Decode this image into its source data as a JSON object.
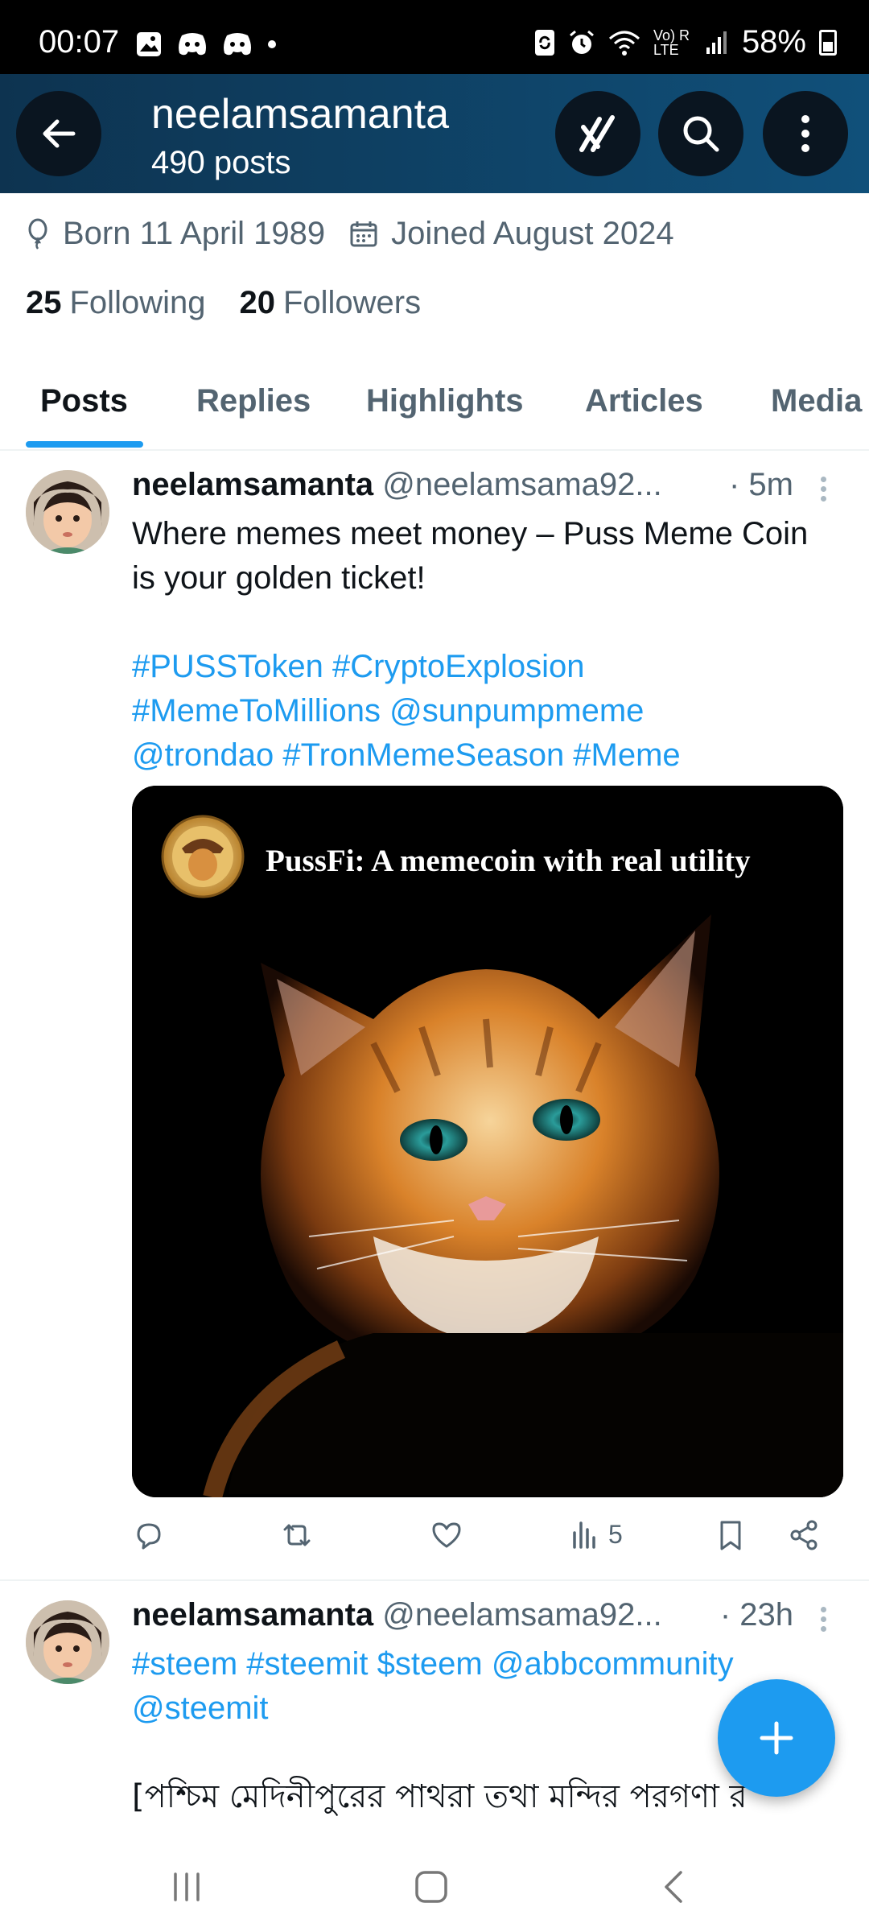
{
  "status_bar": {
    "time": "00:07",
    "battery": "58%",
    "network": "Vo) R LTE"
  },
  "header": {
    "name": "neelamsamanta",
    "posts_count": "490 posts"
  },
  "profile": {
    "born": "Born 11 April 1989",
    "joined": "Joined August 2024",
    "following_count": "25",
    "following_label": "Following",
    "followers_count": "20",
    "followers_label": "Followers"
  },
  "tabs": [
    "Posts",
    "Replies",
    "Highlights",
    "Articles",
    "Media"
  ],
  "posts": [
    {
      "name": "neelamsamanta",
      "handle": "@neelamsama92...",
      "time": "· 5m",
      "text_line1": "Where memes meet money – Puss Meme Coin",
      "text_line2": "is your golden ticket!",
      "tags_line1": "#PUSSToken #CryptoExplosion",
      "tags_line2": "#MemeToMillions @sunpumpmeme",
      "tags_line3": "@trondao #TronMemeSeason #Meme",
      "image_caption": "PussFi: A memecoin with real utility",
      "views": "5"
    },
    {
      "name": "neelamsamanta",
      "handle": "@neelamsama92...",
      "time": "· 23h",
      "tags_line1": "#steem #steemit $steem @abbcommunity",
      "tags_line2": "@steemit",
      "text_line1": "[পশ্চিম মেদিনীপুরের পাথরা তথা মন্দির পরগণা র"
    }
  ],
  "colors": {
    "accent": "#1d9bf0",
    "header_start": "#0d3350",
    "header_end": "#10507a"
  }
}
